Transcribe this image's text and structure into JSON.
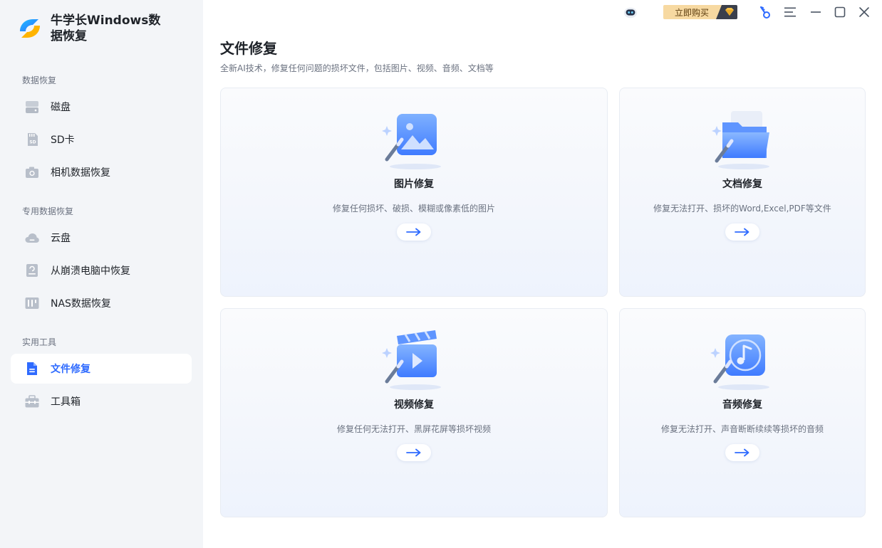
{
  "app": {
    "title": "牛学长Windows数据恢复"
  },
  "titlebar": {
    "buy_label": "立即购买"
  },
  "sidebar": {
    "sections": [
      {
        "label": "数据恢复"
      },
      {
        "label": "专用数据恢复"
      },
      {
        "label": "实用工具"
      }
    ],
    "items": [
      {
        "label": "磁盘",
        "icon": "disk-icon"
      },
      {
        "label": "SD卡",
        "icon": "sd-card-icon"
      },
      {
        "label": "相机数据恢复",
        "icon": "camera-icon"
      },
      {
        "label": "云盘",
        "icon": "cloud-icon"
      },
      {
        "label": "从崩溃电脑中恢复",
        "icon": "crashed-pc-icon"
      },
      {
        "label": "NAS数据恢复",
        "icon": "nas-icon"
      },
      {
        "label": "文件修复",
        "icon": "file-repair-icon",
        "active": true
      },
      {
        "label": "工具箱",
        "icon": "toolbox-icon"
      }
    ]
  },
  "main": {
    "title": "文件修复",
    "subtitle": "全新AI技术，修复任何问题的损坏文件，包括图片、视频、音频、文档等",
    "cards": [
      {
        "title": "图片修复",
        "desc": "修复任何损坏、破损、模糊或像素低的图片",
        "icon": "image-repair-icon"
      },
      {
        "title": "文档修复",
        "desc": "修复无法打开、损坏的Word,Excel,PDF等文件",
        "icon": "document-repair-icon"
      },
      {
        "title": "视频修复",
        "desc": "修复任何无法打开、黑屏花屏等损坏视频",
        "icon": "video-repair-icon"
      },
      {
        "title": "音频修复",
        "desc": "修复无法打开、声音断断续续等损坏的音频",
        "icon": "audio-repair-icon"
      }
    ]
  },
  "colors": {
    "accent": "#2f6bff",
    "sidebar_bg": "#f3f5f8",
    "buy_bg": "#f7d9a1"
  }
}
